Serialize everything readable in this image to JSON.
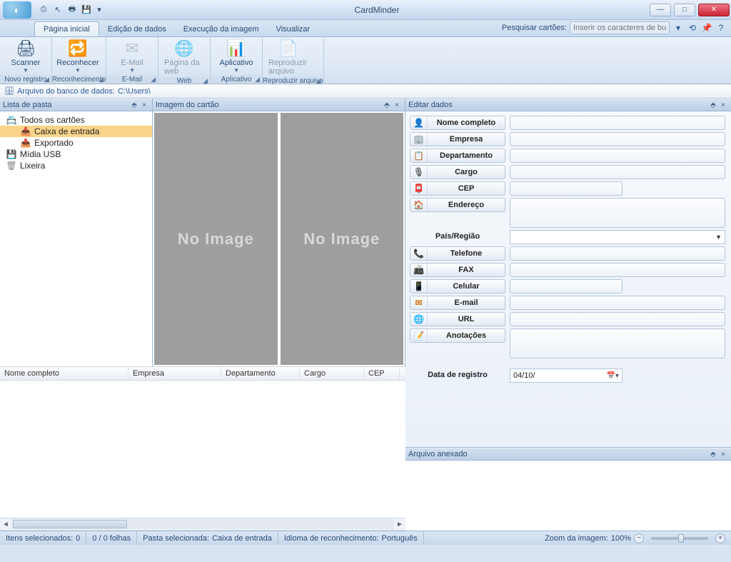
{
  "app": {
    "title": "CardMinder"
  },
  "qat_icons": [
    "scan-icon",
    "cursor-icon",
    "print-icon",
    "save-icon"
  ],
  "window_buttons": {
    "min": "—",
    "max": "□",
    "close": "✕"
  },
  "tabs": [
    {
      "label": "Página inicial",
      "active": true
    },
    {
      "label": "Edição de dados",
      "active": false
    },
    {
      "label": "Execução da imagem",
      "active": false
    },
    {
      "label": "Visualizar",
      "active": false
    }
  ],
  "search": {
    "label": "Pesquisar cartões:",
    "placeholder": "Inserir os caracteres de busca"
  },
  "ribbon_groups": [
    {
      "name": "Novo registro",
      "buttons": [
        {
          "label": "Scanner",
          "icon": "🖨",
          "dropdown": true
        }
      ]
    },
    {
      "name": "Reconhecimento",
      "buttons": [
        {
          "label": "Reconhecer",
          "icon": "🔁",
          "dropdown": true
        }
      ]
    },
    {
      "name": "E-Mail",
      "buttons": [
        {
          "label": "E-Mail",
          "icon": "✉",
          "dropdown": true,
          "disabled": true
        }
      ]
    },
    {
      "name": "Web",
      "buttons": [
        {
          "label": "Página da web",
          "icon": "🌐",
          "disabled": true
        }
      ]
    },
    {
      "name": "Aplicativo",
      "buttons": [
        {
          "label": "Aplicativo",
          "icon": "📊",
          "dropdown": true
        }
      ]
    },
    {
      "name": "Reproduzir arquivo",
      "buttons": [
        {
          "label": "Reproduzir arquivo",
          "icon": "📄",
          "disabled": true
        }
      ]
    }
  ],
  "pathbar": {
    "label": "Arquivo do banco de dados:",
    "path": "C:\\Users\\"
  },
  "panels": {
    "folder_list": "Lista de pasta",
    "card_image": "Imagem do cartão",
    "edit_data": "Editar dados",
    "attached_file": "Arquivo anexado"
  },
  "tree": [
    {
      "label": "Todos os cartões",
      "icon": "cards",
      "level": 0
    },
    {
      "label": "Caixa de entrada",
      "icon": "inbox",
      "level": 1,
      "selected": true
    },
    {
      "label": "Exportado",
      "icon": "export",
      "level": 1
    },
    {
      "label": "Mídia USB",
      "icon": "usb",
      "level": 0
    },
    {
      "label": "Lixeira",
      "icon": "trash",
      "level": 0
    }
  ],
  "no_image_text": "No Image",
  "list_columns": [
    "Nome completo",
    "Empresa",
    "Departamento",
    "Cargo",
    "CEP"
  ],
  "form_fields": [
    {
      "key": "nome",
      "label": "Nome completo",
      "icon": "👤",
      "icon_color": "#5aa050",
      "type": "text"
    },
    {
      "key": "empresa",
      "label": "Empresa",
      "icon": "🏢",
      "icon_color": "#888",
      "type": "text"
    },
    {
      "key": "departamento",
      "label": "Departamento",
      "icon": "📋",
      "icon_color": "#c89040",
      "type": "text"
    },
    {
      "key": "cargo",
      "label": "Cargo",
      "icon": "🎙",
      "icon_color": "#666",
      "type": "text"
    },
    {
      "key": "cep",
      "label": "CEP",
      "icon": "📮",
      "icon_color": "#d04040",
      "type": "short"
    },
    {
      "key": "endereco",
      "label": "Endereço",
      "icon": "🏠",
      "icon_color": "#d0a030",
      "type": "tall"
    },
    {
      "key": "pais",
      "label": "País/Região",
      "plain": true,
      "type": "combo"
    },
    {
      "key": "telefone",
      "label": "Telefone",
      "icon": "📞",
      "icon_color": "#3060b0",
      "type": "text"
    },
    {
      "key": "fax",
      "label": "FAX",
      "icon": "📠",
      "icon_color": "#3060b0",
      "type": "text"
    },
    {
      "key": "celular",
      "label": "Celular",
      "icon": "📱",
      "icon_color": "#3080c0",
      "type": "short"
    },
    {
      "key": "email",
      "label": "E-mail",
      "icon": "✉",
      "icon_color": "#d08020",
      "type": "text"
    },
    {
      "key": "url",
      "label": "URL",
      "icon": "🌐",
      "icon_color": "#3080c0",
      "type": "text"
    },
    {
      "key": "anotacoes",
      "label": "Anotações",
      "icon": "📝",
      "icon_color": "#888",
      "type": "tall"
    },
    {
      "key": "data_registro",
      "label": "Data de registro",
      "plain": true,
      "type": "date",
      "value": "04/10/"
    }
  ],
  "status": {
    "items_selected_label": "Itens selecionados:",
    "items_selected_count": "0",
    "sheets": "0 / 0 folhas",
    "folder_label": "Pasta selecionada:",
    "folder_value": "Caixa de entrada",
    "lang_label": "Idioma de reconhecimento:",
    "lang_value": "Português",
    "zoom_label": "Zoom da imagem:",
    "zoom_value": "100%"
  }
}
